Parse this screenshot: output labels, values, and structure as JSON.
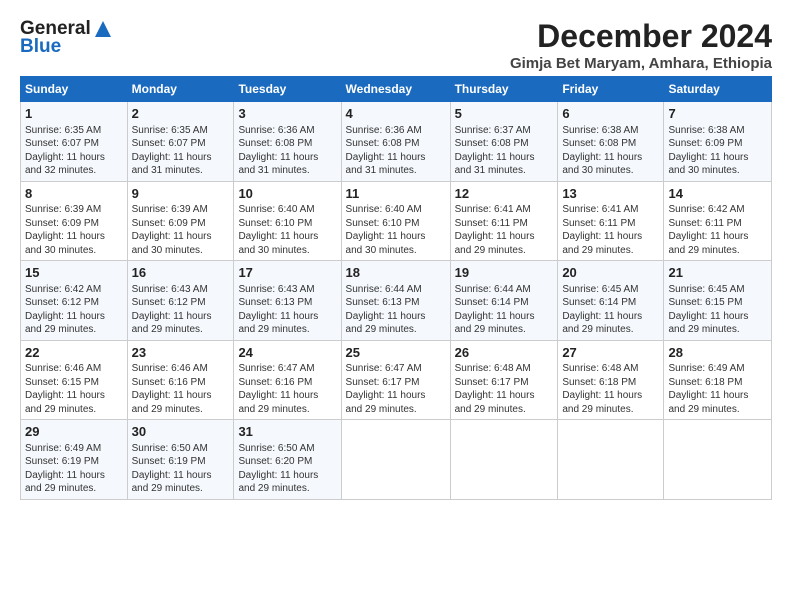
{
  "logo": {
    "general": "General",
    "blue": "Blue"
  },
  "title": "December 2024",
  "subtitle": "Gimja Bet Maryam, Amhara, Ethiopia",
  "days_of_week": [
    "Sunday",
    "Monday",
    "Tuesday",
    "Wednesday",
    "Thursday",
    "Friday",
    "Saturday"
  ],
  "weeks": [
    [
      {
        "day": "1",
        "info": "Sunrise: 6:35 AM\nSunset: 6:07 PM\nDaylight: 11 hours\nand 32 minutes."
      },
      {
        "day": "2",
        "info": "Sunrise: 6:35 AM\nSunset: 6:07 PM\nDaylight: 11 hours\nand 31 minutes."
      },
      {
        "day": "3",
        "info": "Sunrise: 6:36 AM\nSunset: 6:08 PM\nDaylight: 11 hours\nand 31 minutes."
      },
      {
        "day": "4",
        "info": "Sunrise: 6:36 AM\nSunset: 6:08 PM\nDaylight: 11 hours\nand 31 minutes."
      },
      {
        "day": "5",
        "info": "Sunrise: 6:37 AM\nSunset: 6:08 PM\nDaylight: 11 hours\nand 31 minutes."
      },
      {
        "day": "6",
        "info": "Sunrise: 6:38 AM\nSunset: 6:08 PM\nDaylight: 11 hours\nand 30 minutes."
      },
      {
        "day": "7",
        "info": "Sunrise: 6:38 AM\nSunset: 6:09 PM\nDaylight: 11 hours\nand 30 minutes."
      }
    ],
    [
      {
        "day": "8",
        "info": "Sunrise: 6:39 AM\nSunset: 6:09 PM\nDaylight: 11 hours\nand 30 minutes."
      },
      {
        "day": "9",
        "info": "Sunrise: 6:39 AM\nSunset: 6:09 PM\nDaylight: 11 hours\nand 30 minutes."
      },
      {
        "day": "10",
        "info": "Sunrise: 6:40 AM\nSunset: 6:10 PM\nDaylight: 11 hours\nand 30 minutes."
      },
      {
        "day": "11",
        "info": "Sunrise: 6:40 AM\nSunset: 6:10 PM\nDaylight: 11 hours\nand 30 minutes."
      },
      {
        "day": "12",
        "info": "Sunrise: 6:41 AM\nSunset: 6:11 PM\nDaylight: 11 hours\nand 29 minutes."
      },
      {
        "day": "13",
        "info": "Sunrise: 6:41 AM\nSunset: 6:11 PM\nDaylight: 11 hours\nand 29 minutes."
      },
      {
        "day": "14",
        "info": "Sunrise: 6:42 AM\nSunset: 6:11 PM\nDaylight: 11 hours\nand 29 minutes."
      }
    ],
    [
      {
        "day": "15",
        "info": "Sunrise: 6:42 AM\nSunset: 6:12 PM\nDaylight: 11 hours\nand 29 minutes."
      },
      {
        "day": "16",
        "info": "Sunrise: 6:43 AM\nSunset: 6:12 PM\nDaylight: 11 hours\nand 29 minutes."
      },
      {
        "day": "17",
        "info": "Sunrise: 6:43 AM\nSunset: 6:13 PM\nDaylight: 11 hours\nand 29 minutes."
      },
      {
        "day": "18",
        "info": "Sunrise: 6:44 AM\nSunset: 6:13 PM\nDaylight: 11 hours\nand 29 minutes."
      },
      {
        "day": "19",
        "info": "Sunrise: 6:44 AM\nSunset: 6:14 PM\nDaylight: 11 hours\nand 29 minutes."
      },
      {
        "day": "20",
        "info": "Sunrise: 6:45 AM\nSunset: 6:14 PM\nDaylight: 11 hours\nand 29 minutes."
      },
      {
        "day": "21",
        "info": "Sunrise: 6:45 AM\nSunset: 6:15 PM\nDaylight: 11 hours\nand 29 minutes."
      }
    ],
    [
      {
        "day": "22",
        "info": "Sunrise: 6:46 AM\nSunset: 6:15 PM\nDaylight: 11 hours\nand 29 minutes."
      },
      {
        "day": "23",
        "info": "Sunrise: 6:46 AM\nSunset: 6:16 PM\nDaylight: 11 hours\nand 29 minutes."
      },
      {
        "day": "24",
        "info": "Sunrise: 6:47 AM\nSunset: 6:16 PM\nDaylight: 11 hours\nand 29 minutes."
      },
      {
        "day": "25",
        "info": "Sunrise: 6:47 AM\nSunset: 6:17 PM\nDaylight: 11 hours\nand 29 minutes."
      },
      {
        "day": "26",
        "info": "Sunrise: 6:48 AM\nSunset: 6:17 PM\nDaylight: 11 hours\nand 29 minutes."
      },
      {
        "day": "27",
        "info": "Sunrise: 6:48 AM\nSunset: 6:18 PM\nDaylight: 11 hours\nand 29 minutes."
      },
      {
        "day": "28",
        "info": "Sunrise: 6:49 AM\nSunset: 6:18 PM\nDaylight: 11 hours\nand 29 minutes."
      }
    ],
    [
      {
        "day": "29",
        "info": "Sunrise: 6:49 AM\nSunset: 6:19 PM\nDaylight: 11 hours\nand 29 minutes."
      },
      {
        "day": "30",
        "info": "Sunrise: 6:50 AM\nSunset: 6:19 PM\nDaylight: 11 hours\nand 29 minutes."
      },
      {
        "day": "31",
        "info": "Sunrise: 6:50 AM\nSunset: 6:20 PM\nDaylight: 11 hours\nand 29 minutes."
      },
      {
        "day": "",
        "info": ""
      },
      {
        "day": "",
        "info": ""
      },
      {
        "day": "",
        "info": ""
      },
      {
        "day": "",
        "info": ""
      }
    ]
  ]
}
